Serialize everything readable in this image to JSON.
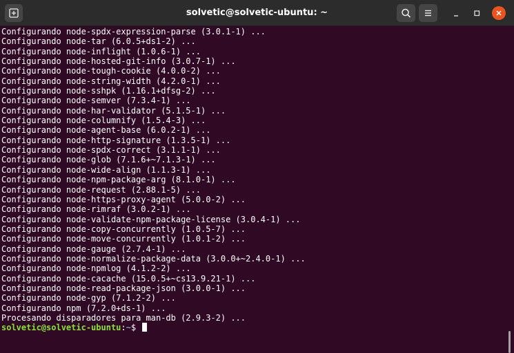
{
  "window": {
    "title": "solvetic@solvetic-ubuntu: ~"
  },
  "toolbar": {
    "icons": [
      "new-tab-icon",
      "search-icon",
      "hamburger-menu-icon",
      "minimize-icon",
      "maximize-icon",
      "close-icon"
    ]
  },
  "terminal": {
    "lines": [
      "Configurando node-spdx-expression-parse (3.0.1-1) ...",
      "Configurando node-tar (6.0.5+ds1-2) ...",
      "Configurando node-inflight (1.0.6-1) ...",
      "Configurando node-hosted-git-info (3.0.7-1) ...",
      "Configurando node-tough-cookie (4.0.0-2) ...",
      "Configurando node-string-width (4.2.0-1) ...",
      "Configurando node-sshpk (1.16.1+dfsg-2) ...",
      "Configurando node-semver (7.3.4-1) ...",
      "Configurando node-har-validator (5.1.5-1) ...",
      "Configurando node-columnify (1.5.4-3) ...",
      "Configurando node-agent-base (6.0.2-1) ...",
      "Configurando node-http-signature (1.3.5-1) ...",
      "Configurando node-spdx-correct (3.1.1-1) ...",
      "Configurando node-glob (7.1.6+~7.1.3-1) ...",
      "Configurando node-wide-align (1.1.3-1) ...",
      "Configurando node-npm-package-arg (8.1.0-1) ...",
      "Configurando node-request (2.88.1-5) ...",
      "Configurando node-https-proxy-agent (5.0.0-2) ...",
      "Configurando node-rimraf (3.0.2-1) ...",
      "Configurando node-validate-npm-package-license (3.0.4-1) ...",
      "Configurando node-copy-concurrently (1.0.5-7) ...",
      "Configurando node-move-concurrently (1.0.1-2) ...",
      "Configurando node-gauge (2.7.4-1) ...",
      "Configurando node-normalize-package-data (3.0.0+~2.4.0-1) ...",
      "Configurando node-npmlog (4.1.2-2) ...",
      "Configurando node-cacache (15.0.5+~cs13.9.21-1) ...",
      "Configurando node-read-package-json (3.0.0-1) ...",
      "Configurando node-gyp (7.1.2-2) ...",
      "Configurando npm (7.2.0+ds-1) ...",
      "Procesando disparadores para man-db (2.9.3-2) ..."
    ],
    "prompt": {
      "user_host": "solvetic@solvetic-ubuntu",
      "separator": ":",
      "path": "~",
      "symbol": "$ "
    }
  },
  "colors": {
    "terminal_bg": "#300a24",
    "titlebar_bg": "#2c2c2c",
    "prompt_user": "#8ae234",
    "prompt_path": "#729fcf",
    "close_button": "#e95420"
  }
}
